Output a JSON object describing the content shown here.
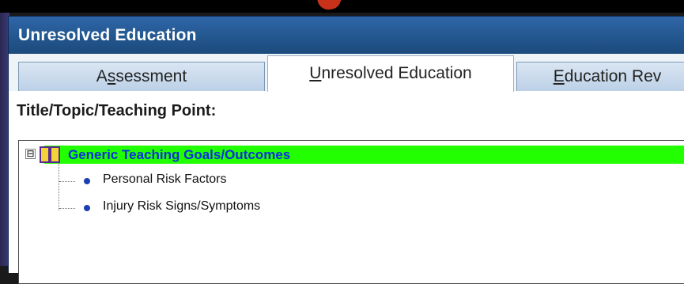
{
  "window": {
    "title": "Unresolved Education"
  },
  "tabs": [
    {
      "label": "Assessment",
      "mnemonic_prefix": "A",
      "mnemonic": "s",
      "rest": "sessment",
      "active": false
    },
    {
      "label": "Unresolved Education",
      "mnemonic": "U",
      "rest": "nresolved Education",
      "active": true
    },
    {
      "label": "Education Rev",
      "mnemonic": "E",
      "rest": "ducation Rev",
      "active": false
    }
  ],
  "section": {
    "label": "Title/Topic/Teaching Point:"
  },
  "tree": {
    "expander": "⊟",
    "parent": {
      "label": "Generic Teaching Goals/Outcomes",
      "icon": "book-icon",
      "selected": true
    },
    "children": [
      {
        "label": "Personal Risk Factors"
      },
      {
        "label": "Injury Risk Signs/Symptoms"
      }
    ]
  },
  "colors": {
    "titlebar": "#23578f",
    "selection": "#22ff00",
    "selected_text": "#0a2fe0",
    "bullet": "#1a3fb5"
  }
}
